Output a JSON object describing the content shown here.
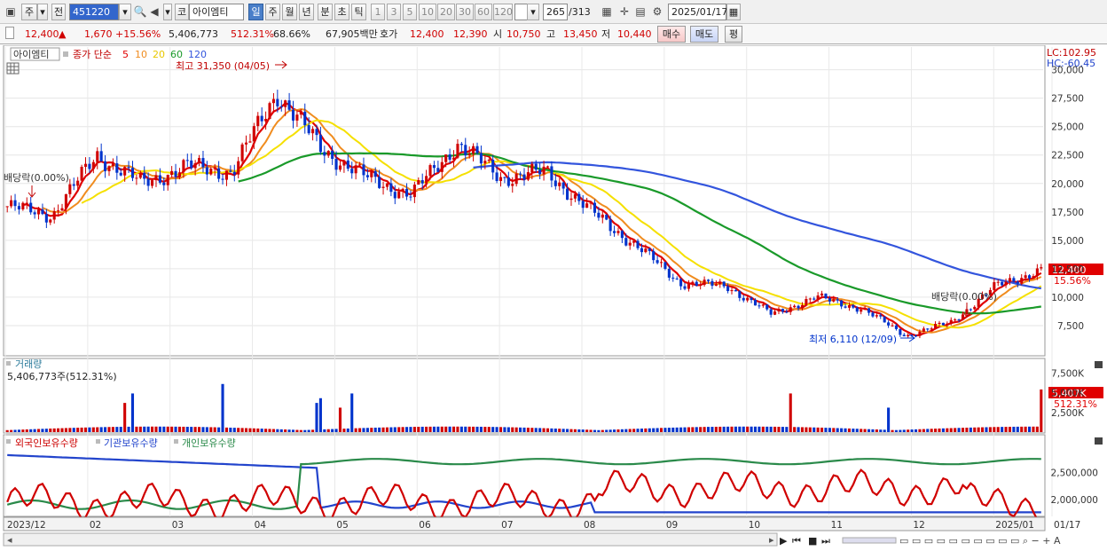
{
  "toolbar": {
    "tab1": "주",
    "tab2": "전",
    "code": "451220",
    "market": "코",
    "name": "아이엠티",
    "periods": [
      "일",
      "주",
      "월",
      "년",
      "분",
      "초",
      "틱"
    ],
    "active_period": "일",
    "intervals": [
      "1",
      "3",
      "5",
      "10",
      "20",
      "30",
      "60",
      "120"
    ],
    "count": "265",
    "total": "/313",
    "date": "2025/01/17"
  },
  "quote": {
    "price": "12,400",
    "arrow": "▲",
    "change": "1,670",
    "pct": "+15.56%",
    "volume": "5,406,773",
    "vol_ratio": "512.31%",
    "turnover": "68.66%",
    "amount": "67,905백만",
    "ask_label": "호가",
    "ask": "12,400",
    "bid": "12,390",
    "open_label": "시",
    "open": "10,750",
    "high_label": "고",
    "high": "13,450",
    "low_label": "저",
    "low": "10,440",
    "buy": "매수",
    "sell": "매도",
    "eval": "평"
  },
  "legend": {
    "name": "아이엠티",
    "type": "종가 단순",
    "ma": [
      "5",
      "10",
      "20",
      "60",
      "120"
    ],
    "lc": "LC:102.95",
    "hc": "HC:-60.45",
    "high_note": "최고 31,350 (04/05)",
    "low_note": "최저 6,110 (12/09)",
    "div1": "배당락(0.00%)",
    "div2": "배당락(0.00%)",
    "price_tag": "12,400",
    "pct_tag": "15.56%"
  },
  "volume_panel": {
    "title": "거래량",
    "value": "5,406,773주(512.31%)",
    "tag": "5,407K",
    "tag_pct": "512.31%"
  },
  "holdings_panel": {
    "items": [
      "외국인보유수량",
      "기관보유수량",
      "개인보유수량"
    ]
  },
  "colors": {
    "up": "#d00000",
    "down": "#0033cc",
    "ma5": "#e00000",
    "ma10": "#f08c1e",
    "ma20": "#f5e000",
    "ma60": "#1a9a2a",
    "ma120": "#3355dd"
  },
  "chart_data": {
    "type": "candlestick",
    "x_labels": [
      "2023/12",
      "02",
      "03",
      "04",
      "05",
      "06",
      "07",
      "08",
      "09",
      "10",
      "11",
      "12",
      "2025/01",
      "01/17"
    ],
    "y_ticks": [
      "30,000",
      "27,500",
      "25,000",
      "22,500",
      "20,000",
      "17,500",
      "15,000",
      "12,500",
      "10,000",
      "7,500"
    ],
    "volume_ticks": [
      "7,500K",
      "5,000K",
      "2,500K"
    ],
    "holding_ticks": [
      "2,500,000",
      "2,000,000"
    ],
    "close_series": [
      {
        "date": "2023/12",
        "close": 18000
      },
      {
        "date": "01",
        "close": 17200
      },
      {
        "date": "02-early",
        "close": 22500
      },
      {
        "date": "02-mid",
        "close": 20000
      },
      {
        "date": "03",
        "close": 21500
      },
      {
        "date": "03-end",
        "close": 21000
      },
      {
        "date": "04/05",
        "close": 28000
      },
      {
        "date": "04-mid",
        "close": 23000
      },
      {
        "date": "05",
        "close": 20500
      },
      {
        "date": "05-end",
        "close": 19000
      },
      {
        "date": "06",
        "close": 23500
      },
      {
        "date": "06-mid",
        "close": 20500
      },
      {
        "date": "07",
        "close": 21000
      },
      {
        "date": "07-mid",
        "close": 17500
      },
      {
        "date": "07-end",
        "close": 14500
      },
      {
        "date": "08",
        "close": 11200
      },
      {
        "date": "08-mid",
        "close": 11000
      },
      {
        "date": "09",
        "close": 8500
      },
      {
        "date": "10",
        "close": 10000
      },
      {
        "date": "11",
        "close": 9000
      },
      {
        "date": "12/09",
        "close": 6600
      },
      {
        "date": "12-end",
        "close": 7800
      },
      {
        "date": "2025/01",
        "close": 11000
      },
      {
        "date": "01/17",
        "close": 12400
      }
    ]
  }
}
